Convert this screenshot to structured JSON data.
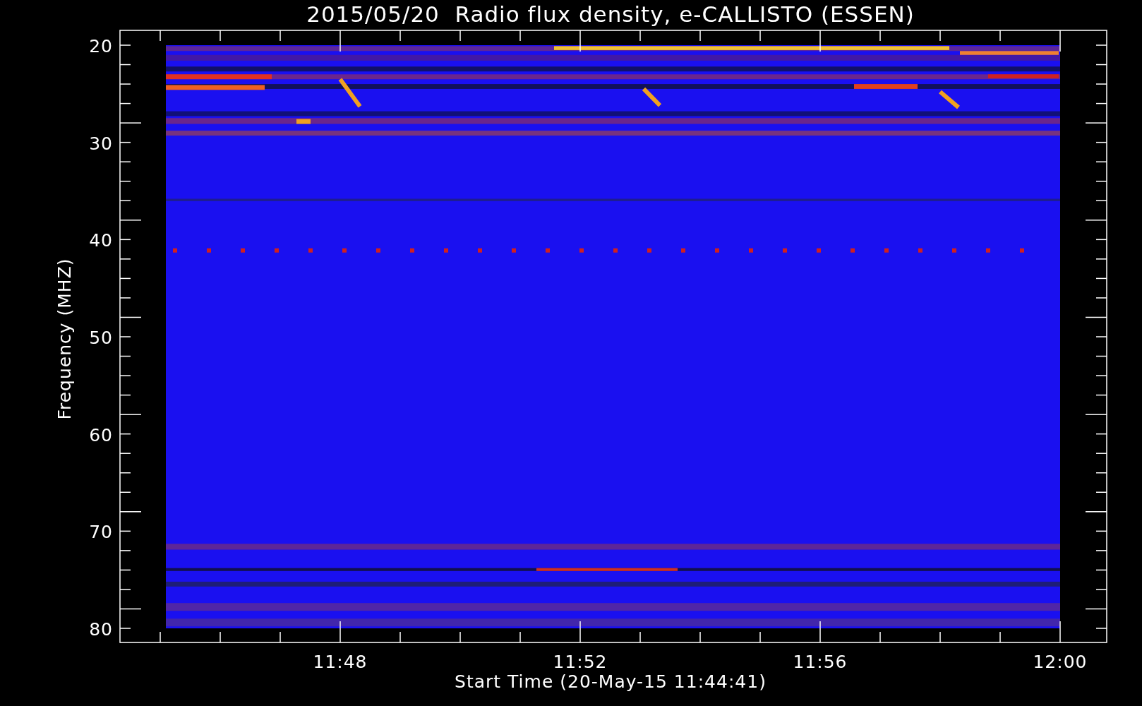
{
  "title": "2015/05/20  Radio flux density, e-CALLISTO (ESSEN)",
  "y_axis": {
    "label": "Frequency (MHZ)",
    "ticks": [
      "20",
      "30",
      "40",
      "50",
      "60",
      "70",
      "80"
    ]
  },
  "x_axis": {
    "label": "Start Time (20-May-15 11:44:41)",
    "ticks": [
      "11:48",
      "11:52",
      "11:56",
      "12:00"
    ]
  }
}
